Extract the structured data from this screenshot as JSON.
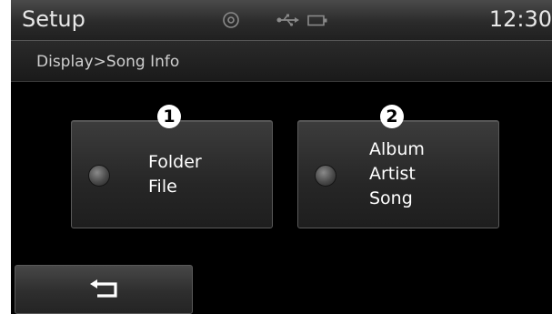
{
  "status_bar": {
    "title": "Setup",
    "time": "12:30",
    "icons": [
      "disc-icon",
      "usb-icon",
      "battery-icon"
    ]
  },
  "breadcrumb": "Display>Song Info",
  "options": [
    {
      "marker": "1",
      "lines": [
        "Folder",
        "File"
      ]
    },
    {
      "marker": "2",
      "lines": [
        "Album",
        "Artist",
        "Song"
      ]
    }
  ],
  "back_button": {
    "icon": "back-arrow-icon"
  },
  "colors": {
    "screen_background": "#000000",
    "text": "#ffffff",
    "button": "#2e2e2e"
  }
}
